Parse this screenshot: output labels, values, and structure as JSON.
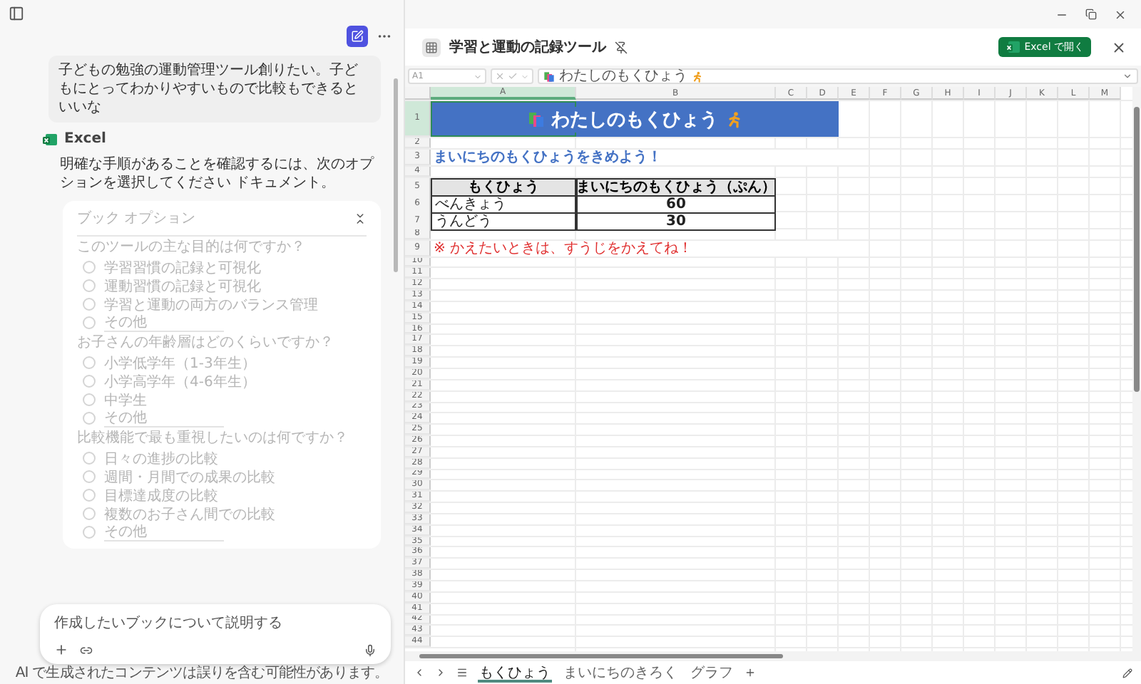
{
  "chat": {
    "user_message": "子どもの勉強の運動管理ツール創りたい。子どもにとってわかりやすいもので比較もできるといいな",
    "assistant_name": "Excel",
    "assistant_message": "明確な手順があることを確認するには、次のオプションを選択してください ドキュメント。",
    "options_card": {
      "title": "ブック オプション",
      "disabled": true,
      "questions": [
        {
          "text": "このツールの主な目的は何ですか？",
          "options": [
            {
              "label": "学習習慣の記録と可視化",
              "kind": "choice",
              "selected": false
            },
            {
              "label": "運動習慣の記録と可視化",
              "kind": "choice",
              "selected": false
            },
            {
              "label": "学習と運動の両方のバランス管理",
              "kind": "choice",
              "selected": false
            },
            {
              "label": "その他",
              "kind": "other",
              "selected": false
            }
          ]
        },
        {
          "text": "お子さんの年齢層はどのくらいですか？",
          "options": [
            {
              "label": "小学低学年（1-3年生）",
              "kind": "choice",
              "selected": false
            },
            {
              "label": "小学高学年（4-6年生）",
              "kind": "choice",
              "selected": false
            },
            {
              "label": "中学生",
              "kind": "choice",
              "selected": false
            },
            {
              "label": "その他",
              "kind": "other",
              "selected": false
            }
          ]
        },
        {
          "text": "比較機能で最も重視したいのは何ですか？",
          "options": [
            {
              "label": "日々の進捗の比較",
              "kind": "choice",
              "selected": false
            },
            {
              "label": "週間・月間での成果の比較",
              "kind": "choice",
              "selected": false
            },
            {
              "label": "目標達成度の比較",
              "kind": "choice",
              "selected": false
            },
            {
              "label": "複数のお子さん間での比較",
              "kind": "choice",
              "selected": false
            },
            {
              "label": "その他",
              "kind": "other",
              "selected": false
            }
          ]
        }
      ]
    }
  },
  "composer": {
    "placeholder": "作成したいブックについて説明する"
  },
  "disclaimer": "AI で生成されたコンテンツは誤りを含む可能性があります。",
  "workbook": {
    "title": "学習と運動の記録ツール",
    "open_button": "Excel で開く",
    "name_box": "A1",
    "formula": "わたしのもくひょう",
    "columns": [
      {
        "label": "A",
        "selected": true
      },
      {
        "label": "B",
        "selected": false
      },
      {
        "label": "C",
        "selected": false
      },
      {
        "label": "D",
        "selected": false
      },
      {
        "label": "E",
        "selected": false
      },
      {
        "label": "F",
        "selected": false
      },
      {
        "label": "G",
        "selected": false
      },
      {
        "label": "H",
        "selected": false
      },
      {
        "label": "I",
        "selected": false
      },
      {
        "label": "J",
        "selected": false
      },
      {
        "label": "K",
        "selected": false
      },
      {
        "label": "L",
        "selected": false
      },
      {
        "label": "M",
        "selected": false
      }
    ],
    "rows": [
      {
        "header": "1",
        "selected": true,
        "cells": [
          {
            "text": "わたしのもくひょう",
            "kind": "title"
          }
        ]
      },
      {
        "header": "2",
        "selected": false
      },
      {
        "header": "3",
        "selected": false,
        "cells": [
          {
            "text": "まいにちのもくひょうをきめよう！",
            "kind": "heading"
          }
        ]
      },
      {
        "header": "4",
        "selected": false
      },
      {
        "header": "5",
        "selected": false,
        "cells": [
          {
            "text": "もくひょう",
            "kind": "table-header"
          },
          {
            "text": "まいにちのもくひょう（ぷん）",
            "kind": "table-header"
          }
        ]
      },
      {
        "header": "6",
        "selected": false,
        "cells": [
          {
            "text": "べんきょう",
            "kind": "table-cell"
          },
          {
            "text": "60",
            "kind": "table-number"
          }
        ]
      },
      {
        "header": "7",
        "selected": false,
        "cells": [
          {
            "text": "うんどう",
            "kind": "table-cell"
          },
          {
            "text": "30",
            "kind": "table-number"
          }
        ]
      },
      {
        "header": "8",
        "selected": false
      },
      {
        "header": "9",
        "selected": false,
        "cells": [
          {
            "text": "※ かえたいときは、すうじをかえてね！",
            "kind": "note"
          }
        ]
      },
      {
        "header": "10",
        "selected": false
      },
      {
        "header": "11",
        "selected": false
      },
      {
        "header": "12",
        "selected": false
      },
      {
        "header": "13",
        "selected": false
      },
      {
        "header": "14",
        "selected": false
      },
      {
        "header": "15",
        "selected": false
      },
      {
        "header": "16",
        "selected": false
      },
      {
        "header": "17",
        "selected": false
      },
      {
        "header": "18",
        "selected": false
      },
      {
        "header": "19",
        "selected": false
      },
      {
        "header": "20",
        "selected": false
      },
      {
        "header": "21",
        "selected": false
      },
      {
        "header": "22",
        "selected": false
      },
      {
        "header": "23",
        "selected": false
      },
      {
        "header": "24",
        "selected": false
      },
      {
        "header": "25",
        "selected": false
      },
      {
        "header": "26",
        "selected": false
      },
      {
        "header": "27",
        "selected": false
      },
      {
        "header": "28",
        "selected": false
      },
      {
        "header": "29",
        "selected": false
      },
      {
        "header": "30",
        "selected": false
      },
      {
        "header": "31",
        "selected": false
      },
      {
        "header": "32",
        "selected": false
      },
      {
        "header": "33",
        "selected": false
      },
      {
        "header": "34",
        "selected": false
      },
      {
        "header": "35",
        "selected": false
      },
      {
        "header": "36",
        "selected": false
      },
      {
        "header": "37",
        "selected": false
      },
      {
        "header": "38",
        "selected": false
      },
      {
        "header": "39",
        "selected": false
      },
      {
        "header": "40",
        "selected": false
      },
      {
        "header": "41",
        "selected": false
      },
      {
        "header": "42",
        "selected": false
      },
      {
        "header": "43",
        "selected": false
      },
      {
        "header": "44",
        "selected": false
      }
    ],
    "sheet_tabs": [
      {
        "label": "もくひょう",
        "selected": true
      },
      {
        "label": "まいにちのきろく",
        "selected": false
      },
      {
        "label": "グラフ",
        "selected": false
      }
    ]
  }
}
